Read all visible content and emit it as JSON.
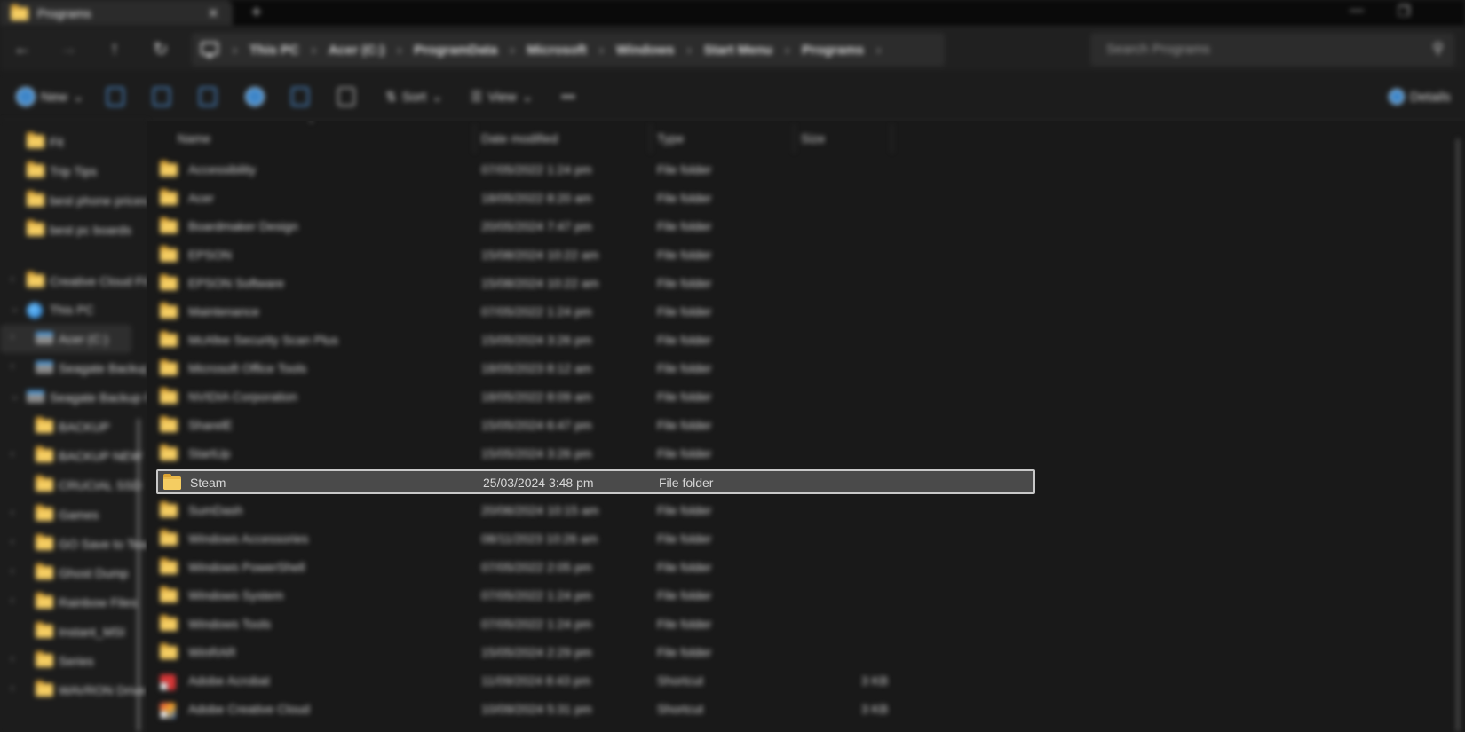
{
  "window": {
    "tab_title": "Programs",
    "tab_close": "✕",
    "new_tab": "+",
    "minimize": "—",
    "maximize": "❐"
  },
  "address": {
    "breadcrumbs": [
      "This PC",
      "Acer (C:)",
      "ProgramData",
      "Microsoft",
      "Windows",
      "Start Menu",
      "Programs"
    ],
    "separator": "›",
    "trailing_separator": "›",
    "search_placeholder": "Search Programs"
  },
  "commandbar": {
    "new_label": "New",
    "sort_label": "Sort",
    "view_label": "View",
    "more_label": "•••",
    "details_label": "Details",
    "dropdown": "⌄"
  },
  "navpane": {
    "items": [
      {
        "label": "Fit",
        "icon": "folder-icon",
        "chevron": ""
      },
      {
        "label": "Trip Tips",
        "icon": "folder-icon",
        "chevron": ""
      },
      {
        "label": "best phone prices",
        "icon": "folder-icon",
        "chevron": ""
      },
      {
        "label": "best pc boards",
        "icon": "folder-icon",
        "chevron": ""
      },
      {
        "label": "Creative Cloud Files",
        "icon": "folder-icon",
        "chevron": "›"
      },
      {
        "label": "This PC",
        "icon": "globe-icon",
        "chevron": "⌄"
      },
      {
        "label": "Acer (C:)",
        "icon": "drive-icon",
        "chevron": "›"
      },
      {
        "label": "Seagate Backup",
        "icon": "drive-icon",
        "chevron": "›"
      },
      {
        "label": "Seagate Backup Plus",
        "icon": "drive-icon",
        "chevron": "⌄"
      },
      {
        "label": "BACKUP",
        "icon": "folder-icon",
        "chevron": ""
      },
      {
        "label": "BACKUP NEW",
        "icon": "folder-icon",
        "chevron": "›"
      },
      {
        "label": "CRUCIAL SSD",
        "icon": "folder-icon",
        "chevron": ""
      },
      {
        "label": "Games",
        "icon": "folder-icon",
        "chevron": "›"
      },
      {
        "label": "GO Save to Team",
        "icon": "folder-icon",
        "chevron": "›"
      },
      {
        "label": "Ghost Dump",
        "icon": "folder-icon",
        "chevron": "›"
      },
      {
        "label": "Rainbow Files",
        "icon": "folder-icon",
        "chevron": "›"
      },
      {
        "label": "Instant_MSI",
        "icon": "folder-icon",
        "chevron": ""
      },
      {
        "label": "Series",
        "icon": "folder-icon",
        "chevron": "›"
      },
      {
        "label": "WAVRON Drive",
        "icon": "folder-icon",
        "chevron": "›"
      }
    ]
  },
  "filelist": {
    "columns": {
      "name": "Name",
      "date": "Date modified",
      "type": "Type",
      "size": "Size"
    },
    "sort_indicator": "^",
    "rows": [
      {
        "name": "Accessibility",
        "date": "07/05/2022 1:24 pm",
        "type": "File folder",
        "size": "",
        "icon": "folder-icon"
      },
      {
        "name": "Acer",
        "date": "18/05/2022 8:20 am",
        "type": "File folder",
        "size": "",
        "icon": "folder-icon"
      },
      {
        "name": "Boardmaker Design",
        "date": "20/05/2024 7:47 pm",
        "type": "File folder",
        "size": "",
        "icon": "folder-icon"
      },
      {
        "name": "EPSON",
        "date": "15/08/2024 10:22 am",
        "type": "File folder",
        "size": "",
        "icon": "folder-icon"
      },
      {
        "name": "EPSON Software",
        "date": "15/08/2024 10:22 am",
        "type": "File folder",
        "size": "",
        "icon": "folder-icon"
      },
      {
        "name": "Maintenance",
        "date": "07/05/2022 1:24 pm",
        "type": "File folder",
        "size": "",
        "icon": "folder-icon"
      },
      {
        "name": "McAfee Security Scan Plus",
        "date": "15/05/2024 3:26 pm",
        "type": "File folder",
        "size": "",
        "icon": "folder-icon"
      },
      {
        "name": "Microsoft Office Tools",
        "date": "18/05/2023 8:12 am",
        "type": "File folder",
        "size": "",
        "icon": "folder-icon"
      },
      {
        "name": "NVIDIA Corporation",
        "date": "18/05/2022 8:09 am",
        "type": "File folder",
        "size": "",
        "icon": "folder-icon"
      },
      {
        "name": "SharelE",
        "date": "15/05/2024 6:47 pm",
        "type": "File folder",
        "size": "",
        "icon": "folder-icon"
      },
      {
        "name": "StartUp",
        "date": "15/05/2024 3:26 pm",
        "type": "File folder",
        "size": "",
        "icon": "folder-icon"
      },
      {
        "name": "Steam",
        "date": "25/03/2024 3:48 pm",
        "type": "File folder",
        "size": "",
        "icon": "folder-icon",
        "selected": true
      },
      {
        "name": "SumDash",
        "date": "20/06/2024 10:15 am",
        "type": "File folder",
        "size": "",
        "icon": "folder-icon"
      },
      {
        "name": "Windows Accessories",
        "date": "08/11/2023 10:26 am",
        "type": "File folder",
        "size": "",
        "icon": "folder-icon"
      },
      {
        "name": "Windows PowerShell",
        "date": "07/05/2022 2:05 pm",
        "type": "File folder",
        "size": "",
        "icon": "folder-icon"
      },
      {
        "name": "Windows System",
        "date": "07/05/2022 1:24 pm",
        "type": "File folder",
        "size": "",
        "icon": "folder-icon"
      },
      {
        "name": "Windows Tools",
        "date": "07/05/2022 1:24 pm",
        "type": "File folder",
        "size": "",
        "icon": "folder-icon"
      },
      {
        "name": "WinRAR",
        "date": "15/05/2024 2:29 pm",
        "type": "File folder",
        "size": "",
        "icon": "folder-icon"
      },
      {
        "name": "Adobe Acrobat",
        "date": "11/09/2024 8:43 pm",
        "type": "Shortcut",
        "size": "3 KB",
        "icon": "acrobat-shortcut-icon"
      },
      {
        "name": "Adobe Creative Cloud",
        "date": "10/09/2024 5:31 pm",
        "type": "Shortcut",
        "size": "3 KB",
        "icon": "creative-cloud-shortcut-icon"
      }
    ]
  },
  "colors": {
    "accent": "#3f86c8",
    "folder": "#f5cd62",
    "selection_bg": "#4a4a4a",
    "selection_border": "#c8c8c8"
  }
}
